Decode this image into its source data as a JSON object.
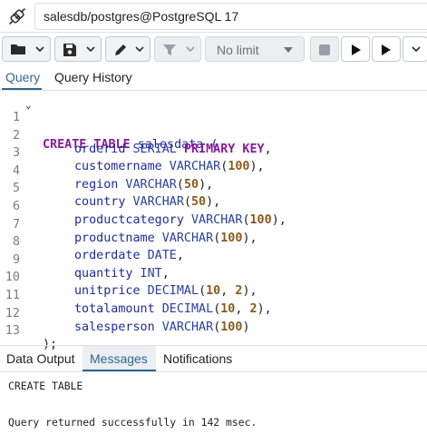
{
  "connection": {
    "label": "salesdb/postgres@PostgreSQL 17",
    "icon": "connection-plug-icon"
  },
  "toolbar": {
    "limit_label": "No limit",
    "icons": [
      "folder-icon",
      "save-icon",
      "edit-pen-icon",
      "filter-icon",
      "stop-icon",
      "execute-icon",
      "execute-script-icon"
    ]
  },
  "editor_tabs": {
    "query": "Query",
    "history": "Query History"
  },
  "editor": {
    "lines": [
      {
        "n": "1"
      },
      {
        "n": "2"
      },
      {
        "n": "3"
      },
      {
        "n": "4"
      },
      {
        "n": "5"
      },
      {
        "n": "6"
      },
      {
        "n": "7"
      },
      {
        "n": "8"
      },
      {
        "n": "9"
      },
      {
        "n": "10"
      },
      {
        "n": "11"
      },
      {
        "n": "12"
      },
      {
        "n": "13"
      }
    ],
    "code": {
      "l1_kw": "CREATE TABLE",
      "l1_name": " salesdata (",
      "l2_col": "orderid",
      "l2_type": " SERIAL",
      "l2_kw": " PRIMARY KEY",
      "l2_end": ",",
      "l3_col": "customername",
      "l3_type": " VARCHAR",
      "l3_num": "100",
      "l4_col": "region",
      "l4_type": " VARCHAR",
      "l4_num": "50",
      "l5_col": "country",
      "l5_type": " VARCHAR",
      "l5_num": "50",
      "l6_col": "productcategory",
      "l6_type": " VARCHAR",
      "l6_num": "100",
      "l7_col": "productname",
      "l7_type": " VARCHAR",
      "l7_num": "100",
      "l8_col": "orderdate",
      "l8_type": " DATE",
      "l9_col": "quantity",
      "l9_type": " INT",
      "l10_col": "unitprice",
      "l10_type": " DECIMAL",
      "l10_num1": "10",
      "l10_num2": "2",
      "l11_col": "totalamount",
      "l11_type": " DECIMAL",
      "l11_num1": "10",
      "l11_num2": "2",
      "l12_col": "salesperson",
      "l12_type": " VARCHAR",
      "l12_num": "100",
      "l13": ");"
    }
  },
  "output_tabs": {
    "data_output": "Data Output",
    "messages": "Messages",
    "notifications": "Notifications"
  },
  "messages": {
    "line1": "CREATE TABLE",
    "line2": "Query returned successfully in 142 msec."
  },
  "colors": {
    "accent": "#326690",
    "keyword": "#8b1a9e",
    "type": "#2a3fa0",
    "number": "#8a5a1a"
  }
}
